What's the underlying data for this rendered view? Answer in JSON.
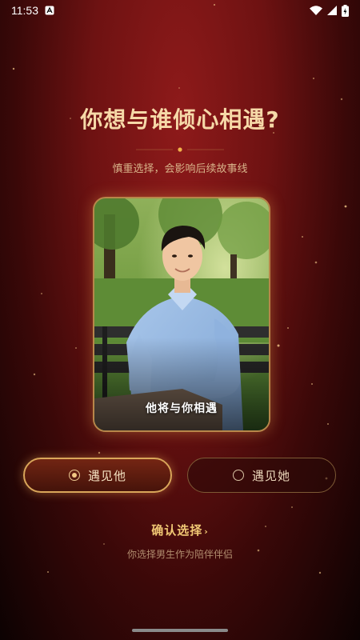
{
  "status_bar": {
    "time": "11:53",
    "icons": [
      "notification-a-icon",
      "wifi-icon",
      "signal-icon",
      "battery-charging-icon"
    ]
  },
  "header": {
    "title": "你想与谁倾心相遇?",
    "subtitle": "慎重选择，会影响后续故事线"
  },
  "card": {
    "caption": "他将与你相遇"
  },
  "options": {
    "him_label": "遇见他",
    "her_label": "遇见她",
    "selected": "him"
  },
  "footer": {
    "confirm_label": "确认选择",
    "hint": "你选择男生作为陪伴伴侣"
  },
  "colors": {
    "accent_gold": "#f0c774",
    "background_red": "#8e1a1a",
    "background_dark": "#0c0202"
  }
}
